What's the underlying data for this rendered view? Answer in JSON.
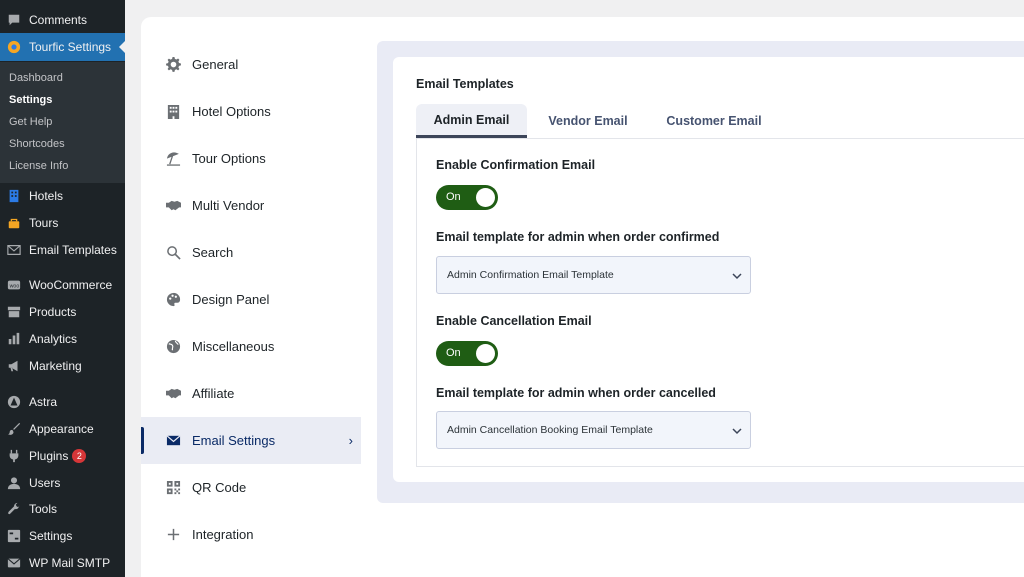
{
  "wp_menu": {
    "items": [
      {
        "label": "Comments",
        "icon": "comment-icon"
      },
      {
        "label": "Tourfic Settings",
        "icon": "tourfic-logo-icon"
      },
      {
        "label": "Hotels",
        "icon": "hotel-icon"
      },
      {
        "label": "Tours",
        "icon": "tour-icon"
      },
      {
        "label": "Email Templates",
        "icon": "envelope-icon"
      },
      {
        "label": "WooCommerce",
        "icon": "woocommerce-icon"
      },
      {
        "label": "Products",
        "icon": "archive-icon"
      },
      {
        "label": "Analytics",
        "icon": "bar-chart-icon"
      },
      {
        "label": "Marketing",
        "icon": "megaphone-icon"
      },
      {
        "label": "Astra",
        "icon": "astra-icon"
      },
      {
        "label": "Appearance",
        "icon": "paintbrush-icon"
      },
      {
        "label": "Plugins",
        "icon": "plugin-icon",
        "badge": "2"
      },
      {
        "label": "Users",
        "icon": "user-icon"
      },
      {
        "label": "Tools",
        "icon": "wrench-icon"
      },
      {
        "label": "Settings",
        "icon": "settings-grid-icon"
      },
      {
        "label": "WP Mail SMTP",
        "icon": "mail-smtp-icon"
      }
    ],
    "submenu": [
      "Dashboard",
      "Settings",
      "Get Help",
      "Shortcodes",
      "License Info"
    ],
    "active": "Tourfic Settings",
    "current_sub": "Settings"
  },
  "settings_nav": {
    "items": [
      {
        "label": "General",
        "icon": "gear-icon"
      },
      {
        "label": "Hotel Options",
        "icon": "building-icon"
      },
      {
        "label": "Tour Options",
        "icon": "umbrella-beach-icon"
      },
      {
        "label": "Multi Vendor",
        "icon": "handshake-icon"
      },
      {
        "label": "Search",
        "icon": "search-icon"
      },
      {
        "label": "Design Panel",
        "icon": "palette-icon"
      },
      {
        "label": "Miscellaneous",
        "icon": "globe-icon"
      },
      {
        "label": "Affiliate",
        "icon": "handshake-icon"
      },
      {
        "label": "Email Settings",
        "icon": "envelope-icon",
        "active": true
      },
      {
        "label": "QR Code",
        "icon": "qr-code-icon"
      },
      {
        "label": "Integration",
        "icon": "plus-icon"
      }
    ]
  },
  "content": {
    "section_title": "Email Templates",
    "tabs": [
      "Admin Email",
      "Vendor Email",
      "Customer Email"
    ],
    "active_tab": "Admin Email",
    "fields": {
      "enable_confirmation_label": "Enable Confirmation Email",
      "enable_confirmation_value": "On",
      "confirm_template_label": "Email template for admin when order confirmed",
      "confirm_template_value": "Admin Confirmation Email Template",
      "enable_cancellation_label": "Enable Cancellation Email",
      "enable_cancellation_value": "On",
      "cancel_template_label": "Email template for admin when order cancelled",
      "cancel_template_value": "Admin Cancellation Booking Email Template"
    }
  },
  "colors": {
    "wp_sidebar_bg": "#1d2327",
    "wp_active_bg": "#2271b1",
    "toggle_on": "#1f5d14",
    "nav_active_text": "#0a2a66"
  }
}
